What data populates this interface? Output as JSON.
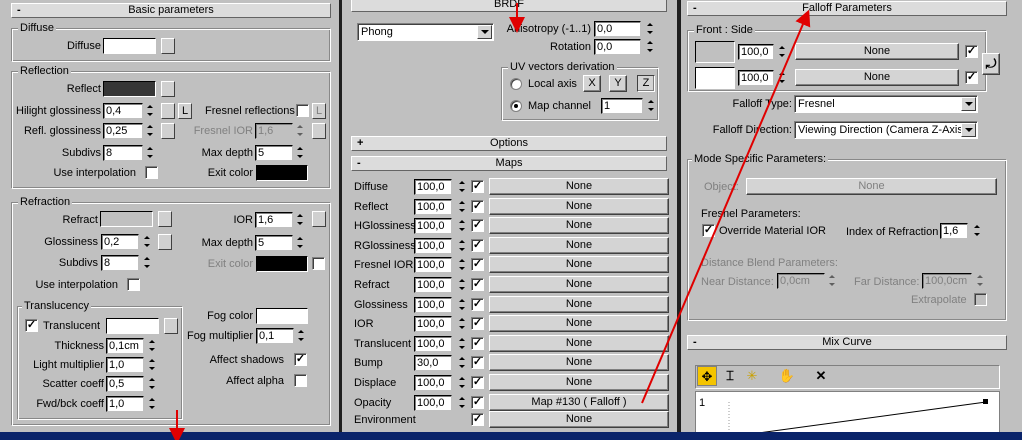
{
  "left": {
    "rollup": {
      "sign": "-",
      "title": "Basic parameters"
    },
    "diffuse": {
      "group": "Diffuse",
      "label": "Diffuse",
      "color": "#ffffff"
    },
    "reflection": {
      "group": "Reflection",
      "reflect": "Reflect",
      "reflect_color": "#363636",
      "hilight_label": "Hilight glossiness",
      "hilight_value": "0,4",
      "hilight_lock": "L",
      "fresnel_label": "Fresnel reflections",
      "fresnel_lock": "L",
      "refl_label": "Refl. glossiness",
      "refl_value": "0,25",
      "fresnel_ior_label": "Fresnel IOR",
      "fresnel_ior_value": "1,6",
      "subdivs_label": "Subdivs",
      "subdivs_value": "8",
      "maxdepth_label": "Max depth",
      "maxdepth_value": "5",
      "interp_label": "Use interpolation",
      "exit_label": "Exit color",
      "exit_color": "#000000"
    },
    "refraction": {
      "group": "Refraction",
      "refract": "Refract",
      "refract_color": "#c0c0c0",
      "ior_label": "IOR",
      "ior_value": "1,6",
      "gloss_label": "Glossiness",
      "gloss_value": "0,2",
      "maxdepth_label": "Max depth",
      "maxdepth_value": "5",
      "subdivs_label": "Subdivs",
      "subdivs_value": "8",
      "exit_label": "Exit color",
      "exit_color": "#000000",
      "interp_label": "Use interpolation",
      "fog_label": "Fog color",
      "fog_color": "#ffffff",
      "fogmult_label": "Fog multiplier",
      "fogmult_value": "0,1",
      "shadows_label": "Affect shadows",
      "alpha_label": "Affect alpha"
    },
    "translucency": {
      "group": "Translucency",
      "translucent_label": "Translucent",
      "translucent_color": "#ffffff",
      "thickness_label": "Thickness",
      "thickness_value": "0,1cm",
      "light_label": "Light multiplier",
      "light_value": "1,0",
      "scatter_label": "Scatter coeff",
      "scatter_value": "0,5",
      "fwd_label": "Fwd/bck coeff",
      "fwd_value": "1,0"
    }
  },
  "middle": {
    "brdf": {
      "title": "BRDF",
      "type": "Phong",
      "aniso_label": "Anisotropy (-1..1)",
      "aniso_value": "0,0",
      "rot_label": "Rotation",
      "rot_value": "0,0",
      "uv_group": "UV vectors derivation",
      "local_axis": "Local axis",
      "x": "X",
      "y": "Y",
      "z": "Z",
      "map_channel": "Map channel",
      "map_channel_value": "1"
    },
    "options": {
      "sign": "+",
      "title": "Options"
    },
    "maps": {
      "sign": "-",
      "title": "Maps",
      "rows": [
        {
          "label": "Diffuse",
          "value": "100,0",
          "map": "None"
        },
        {
          "label": "Reflect",
          "value": "100,0",
          "map": "None"
        },
        {
          "label": "HGlossiness",
          "value": "100,0",
          "map": "None"
        },
        {
          "label": "RGlossiness",
          "value": "100,0",
          "map": "None"
        },
        {
          "label": "Fresnel IOR",
          "value": "100,0",
          "map": "None"
        },
        {
          "label": "Refract",
          "value": "100,0",
          "map": "None"
        },
        {
          "label": "Glossiness",
          "value": "100,0",
          "map": "None"
        },
        {
          "label": "IOR",
          "value": "100,0",
          "map": "None"
        },
        {
          "label": "Translucent",
          "value": "100,0",
          "map": "None"
        },
        {
          "label": "Bump",
          "value": "30,0",
          "map": "None"
        },
        {
          "label": "Displace",
          "value": "100,0",
          "map": "None"
        },
        {
          "label": "Opacity",
          "value": "100,0",
          "map": "Map #130  ( Falloff )"
        }
      ],
      "env_label": "Environment",
      "env_map": "None"
    }
  },
  "right": {
    "falloff": {
      "sign": "-",
      "title": "Falloff Parameters",
      "front_side": "Front : Side",
      "front_value": "100,0",
      "front_map": "None",
      "front_color": "#c0c0c0",
      "side_value": "100,0",
      "side_map": "None",
      "side_color": "#ffffff",
      "type_label": "Falloff Type:",
      "type_value": "Fresnel",
      "dir_label": "Falloff Direction:",
      "dir_value": "Viewing Direction (Camera Z-Axis)"
    },
    "mode": {
      "group": "Mode Specific Parameters:",
      "object_label": "Object:",
      "object_value": "None",
      "fresnel_group": "Fresnel Parameters:",
      "override_label": "Override Material IOR",
      "ior_label": "Index of Refraction",
      "ior_value": "1,6",
      "distance_group": "Distance Blend Parameters:",
      "near_label": "Near Distance:",
      "near_value": "0,0cm",
      "far_label": "Far Distance:",
      "far_value": "100,0cm",
      "extrapolate_label": "Extrapolate"
    },
    "mix": {
      "sign": "-",
      "title": "Mix Curve",
      "y_label": "1"
    }
  },
  "colors": {
    "annotation_arrow": "#e00000",
    "status_bar": "#0a246a"
  }
}
